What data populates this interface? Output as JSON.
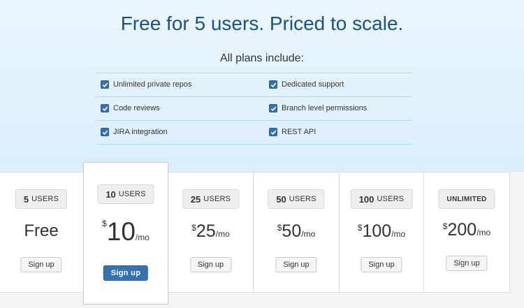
{
  "headline": "Free for 5 users. Priced to scale.",
  "subhead": "All plans include:",
  "features": {
    "left": [
      "Unlimited private repos",
      "Code reviews",
      "JIRA integration"
    ],
    "right": [
      "Dedicated support",
      "Branch level permissions",
      "REST API"
    ]
  },
  "plans": [
    {
      "users": "5",
      "unit": "USERS",
      "currency": "",
      "amount": "Free",
      "period": "",
      "button": "Sign up"
    },
    {
      "users": "10",
      "unit": "USERS",
      "currency": "$",
      "amount": "10",
      "period": "/mo",
      "button": "Sign up"
    },
    {
      "users": "25",
      "unit": "USERS",
      "currency": "$",
      "amount": "25",
      "period": "/mo",
      "button": "Sign up"
    },
    {
      "users": "50",
      "unit": "USERS",
      "currency": "$",
      "amount": "50",
      "period": "/mo",
      "button": "Sign up"
    },
    {
      "users": "100",
      "unit": "USERS",
      "currency": "$",
      "amount": "100",
      "period": "/mo",
      "button": "Sign up"
    },
    {
      "users": "UNLIMITED",
      "unit": "",
      "currency": "$",
      "amount": "200",
      "period": "/mo",
      "button": "Sign up"
    }
  ],
  "colors": {
    "accent": "#3572b0",
    "headline": "#205081",
    "hero_bg": "#dcf0fb"
  },
  "icons": {
    "feature_check": "checkbox-checked-icon"
  }
}
